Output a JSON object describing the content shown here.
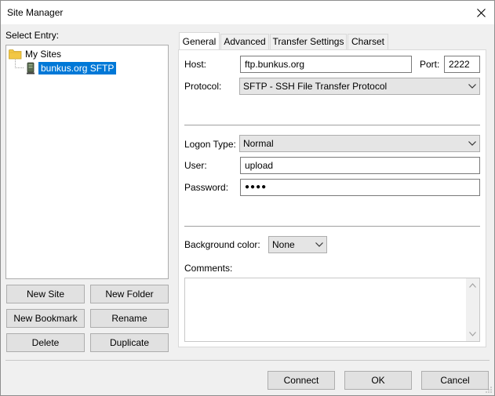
{
  "window": {
    "title": "Site Manager"
  },
  "left": {
    "select_entry_label": "Select Entry:",
    "tree": {
      "root": "My Sites",
      "site": "bunkus.org SFTP"
    },
    "buttons": {
      "new_site": "New Site",
      "new_folder": "New Folder",
      "new_bookmark": "New Bookmark",
      "rename": "Rename",
      "delete": "Delete",
      "duplicate": "Duplicate"
    }
  },
  "tabs": [
    {
      "label": "General"
    },
    {
      "label": "Advanced"
    },
    {
      "label": "Transfer Settings"
    },
    {
      "label": "Charset"
    }
  ],
  "general": {
    "host_label": "Host:",
    "host_value": "ftp.bunkus.org",
    "port_label": "Port:",
    "port_value": "2222",
    "protocol_label": "Protocol:",
    "protocol_value": "SFTP - SSH File Transfer Protocol",
    "logon_type_label": "Logon Type:",
    "logon_type_value": "Normal",
    "user_label": "User:",
    "user_value": "upload",
    "password_label": "Password:",
    "password_value": "●●●●",
    "background_color_label": "Background color:",
    "background_color_value": "None",
    "comments_label": "Comments:"
  },
  "footer": {
    "connect": "Connect",
    "ok": "OK",
    "cancel": "Cancel"
  },
  "colors": {
    "selection": "#0078d7",
    "folder": "#f2c744"
  }
}
